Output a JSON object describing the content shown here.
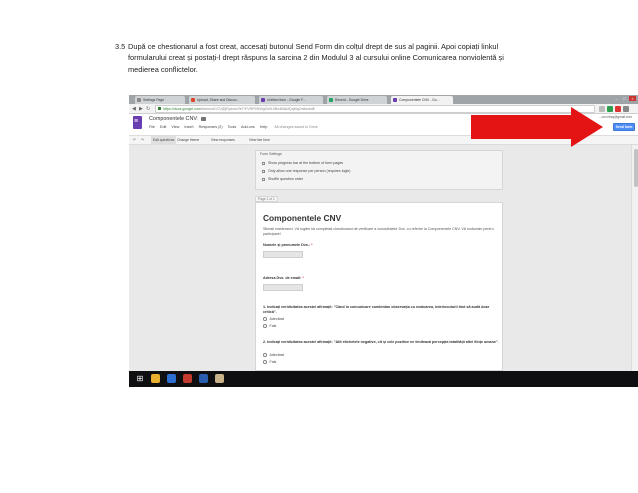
{
  "document": {
    "item_number": "3.5",
    "lines": [
      "După ce chestionarul a fost creat, accesați butonul Send Form din colțul drept de sus al paginii. Apoi copiați linkul",
      "formularului creat și postați-l drept răspuns la sarcina 2 din Modulul 3 al cursului online Comunicarea nonviolentă  și",
      "medierea conflictelor."
    ]
  },
  "screenshot": {
    "browser": {
      "tabs": [
        {
          "label": "Settings Page",
          "active": false
        },
        {
          "label": "Upload, Share and Discov...",
          "active": false
        },
        {
          "label": "Untitled form - Google F...",
          "active": false
        },
        {
          "label": "Recent - Google Drive",
          "active": false
        },
        {
          "label": "Componentele CNV - Go...",
          "active": true
        }
      ],
      "address_secure_part": "https://docs.google.com",
      "address_rest": "/forms/d/1CVjDjRpedu/YeT/FVRP93lWgGWL0Be4BAkfQqMq2ntbo/edit"
    },
    "form_editor": {
      "doc_title": "Componentele CNV",
      "menus": [
        "File",
        "Edit",
        "View",
        "Insert",
        "Responses (2)",
        "Tools",
        "Add-ons",
        "Help"
      ],
      "saved_status": "All changes saved in Drive",
      "user_email": "...cnv.ebay@gmail.com",
      "send_button": "Send form",
      "toolbar": [
        "Edit questions",
        "Change theme",
        "View responses",
        "View live form"
      ],
      "settings_header": "Form Settings",
      "settings_options": [
        "Show progress bar at the bottom of form pages",
        "Only allow one response per person (requires login)",
        "Shuffle question order"
      ],
      "page_label": "Page 1 of 1",
      "form_title": "Componentele CNV",
      "form_description": "Stimați masteranzi. Vă rugăm să completați chestionarul de verificare a cunoștințelor Dvs. cu referire la Componentele CNV. Vă mulțumim pentru participare!",
      "questions": [
        {
          "label": "Numele și prenumele Dvs.:",
          "required": "*"
        },
        {
          "label": "Adresa Dvs. de email:",
          "required": "*"
        }
      ],
      "choice_questions": [
        {
          "text": "1. Indicați veridicitatea acestei afirmații: \"Când în comunicare combinăm observația cu evaluarea, interlocutorii tind să audă doar critică\".",
          "options": [
            "Adevărat",
            "Fals"
          ]
        },
        {
          "text": "2. Indicați veridicitatea acestei afirmații: \"Atît etichetele negative, cît și cele pozitive ne limitează percepția totalității altei ființe umane\".",
          "options": [
            "Adevărat",
            "Fals"
          ]
        }
      ]
    },
    "colors": {
      "annotation_arrow": "#e41414",
      "send_button": "#4d8df5",
      "doc_icon": "#6a3eb0"
    }
  }
}
